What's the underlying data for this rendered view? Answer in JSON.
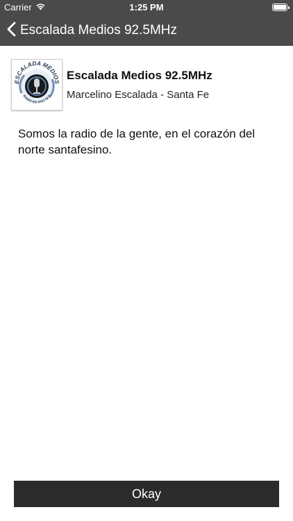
{
  "status": {
    "carrier": "Carrier",
    "time": "1:25 PM",
    "battery_level": 1.0
  },
  "nav": {
    "back_icon": "chevron-left-icon",
    "title": "Escalada Medios 92.5MHz"
  },
  "station": {
    "name": "Escalada Medios 92.5MHz",
    "location": "Marcelino Escalada - Santa Fe",
    "logo": {
      "top_text": "ESCALADA MEDIOS",
      "bottom_text": "RADIO EN VIVO 92.5"
    }
  },
  "description": "Somos la radio de la gente, en el corazón del norte santafesino.",
  "button": {
    "okay_label": "Okay"
  },
  "colors": {
    "bar_background": "#4a4a4a",
    "button_background": "#2b2b2b"
  }
}
